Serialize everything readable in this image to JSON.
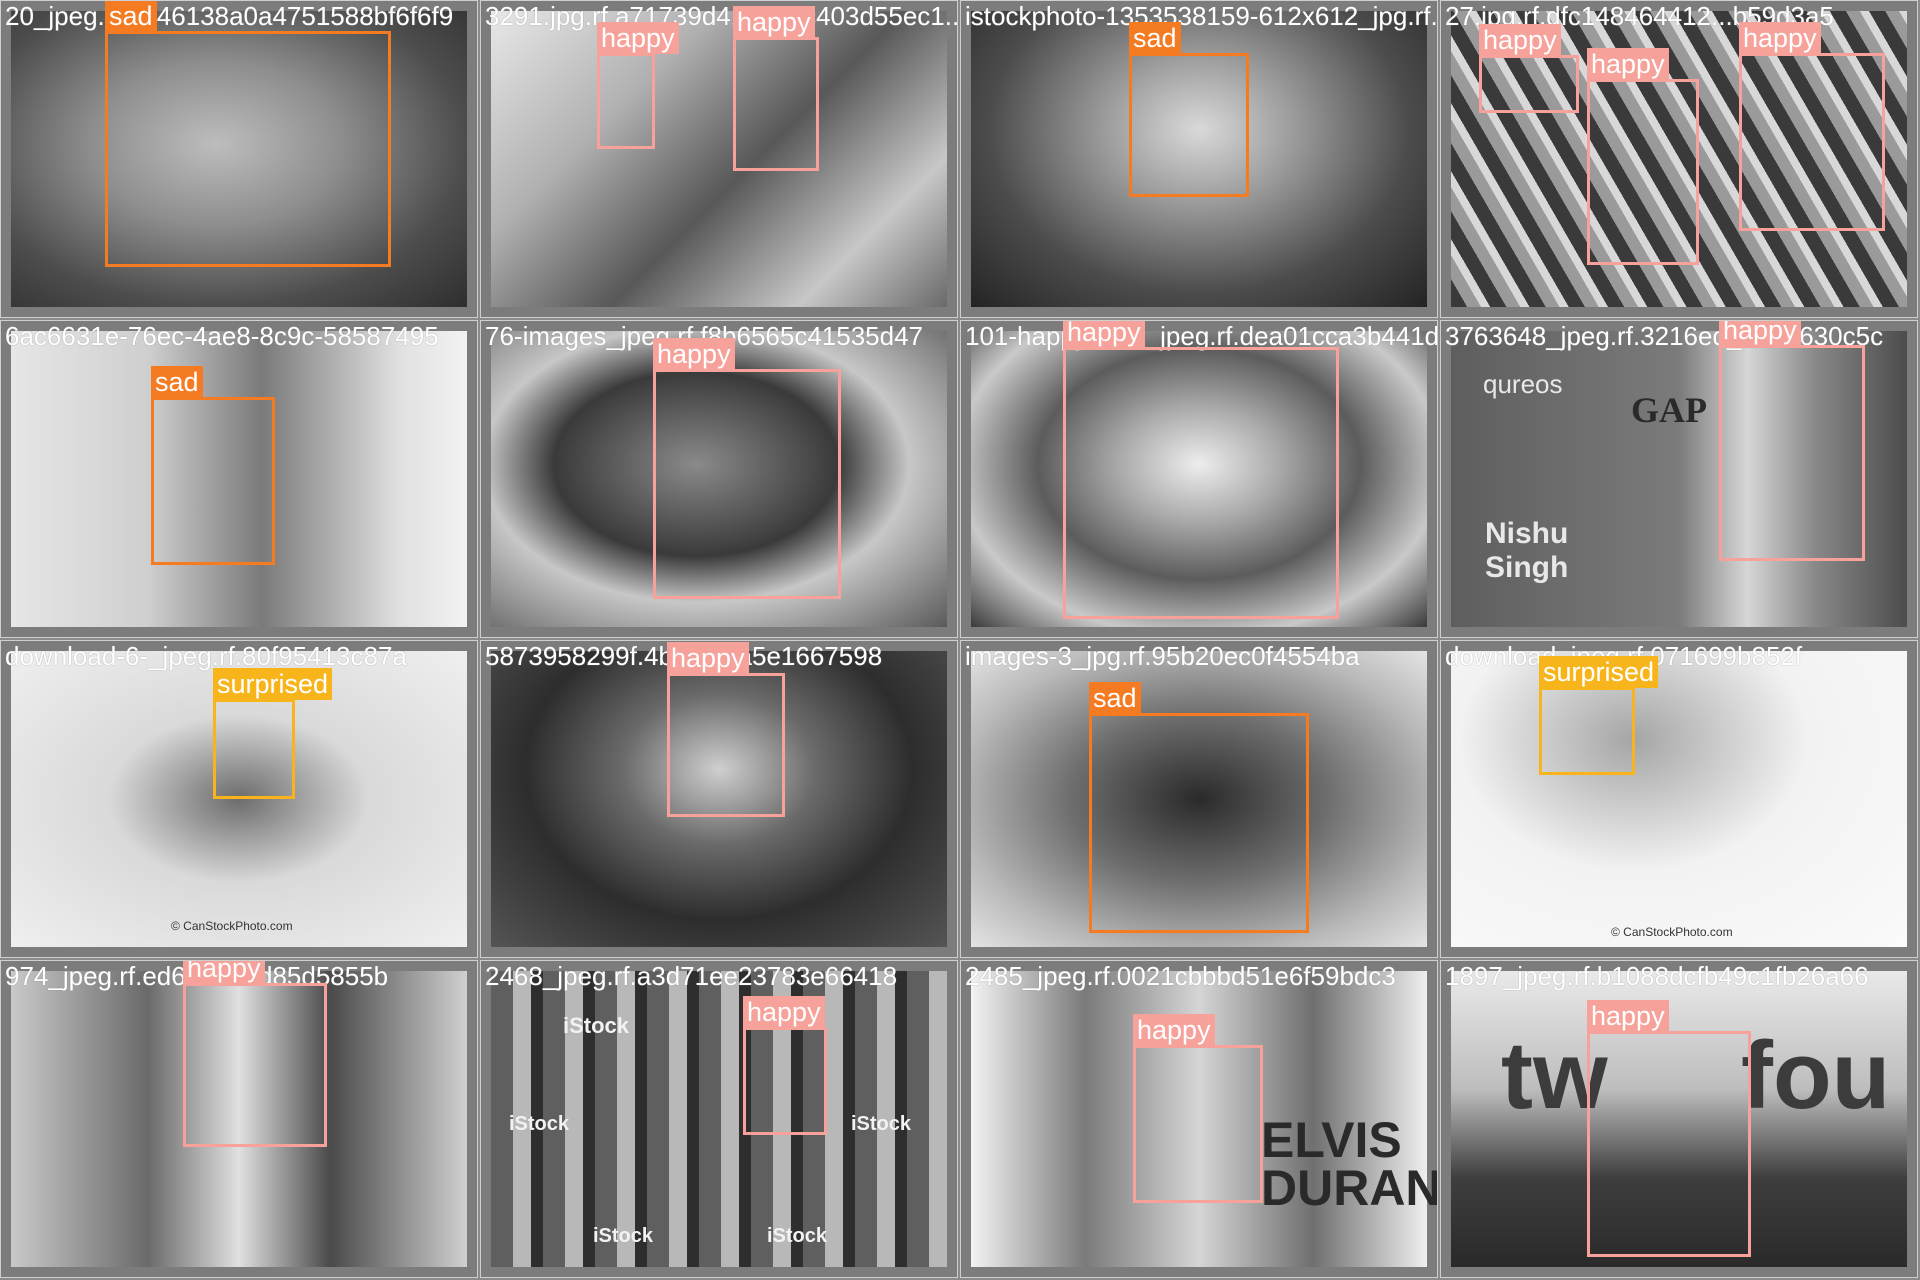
{
  "colors": {
    "sad": "#f47b22",
    "happy": "#f6a19a",
    "surprised": "#f7b51b"
  },
  "tiles": [
    {
      "filename": "20_jpeg.rf.6e46138a0a4751588bf6f6f9",
      "label": "sad"
    },
    {
      "filename": "3291.jpg.rf.a71739d41a1e6c403d55ec1...",
      "label": "happy",
      "label2": "happy"
    },
    {
      "filename": "istockphoto-1353538159-612x612_jpg.rf...",
      "label": "sad"
    },
    {
      "filename": "27.jpg.rf.dfc148464412...b59d3a5",
      "label": "happy",
      "label2": "happy",
      "label3": "happy"
    },
    {
      "filename": "6ac6631e-76ec-4ae8-8c9c-58587495",
      "label": "sad"
    },
    {
      "filename": "76-images_jpeg.rf.f8b6565c41535d47",
      "label": "happy"
    },
    {
      "filename": "101-happy-face_jpeg.rf.dea01cca3b441d7de",
      "label": "happy"
    },
    {
      "filename": "3763648_jpeg.rf.3216ed_0510630c5c",
      "label": "happy",
      "text1": "qureos",
      "text2": "GAP",
      "text3": "Nishu",
      "text4": "Singh"
    },
    {
      "filename": "download-6-_jpeg.rf.80f95413c87a",
      "label": "surprised",
      "watermark": "© CanStockPhoto.com"
    },
    {
      "filename": "5873958299f.4b2ffadfa5e1667598",
      "label": "happy"
    },
    {
      "filename": "images-3_jpg.rf.95b20ec0f4554ba",
      "label": "sad"
    },
    {
      "filename": "download_jpeg.rf.071699b852f",
      "label": "surprised",
      "watermark": "© CanStockPhoto.com"
    },
    {
      "filename": "974_jpeg.rf.ed6d3234d85d5855b",
      "label": "happy"
    },
    {
      "filename": "2468_jpeg.rf.a3d71ee23783e66418",
      "label": "happy",
      "text1": "iStock"
    },
    {
      "filename": "2485_jpeg.rf.0021cbbbd51e6f59bdc3",
      "label": "happy",
      "text1": "ELVIS",
      "text2": "DURAN"
    },
    {
      "filename": "1897_jpeg.rf.b1088dcfb49c1fb26a66",
      "label": "happy",
      "text1": "tw",
      "text2": "fou"
    }
  ]
}
